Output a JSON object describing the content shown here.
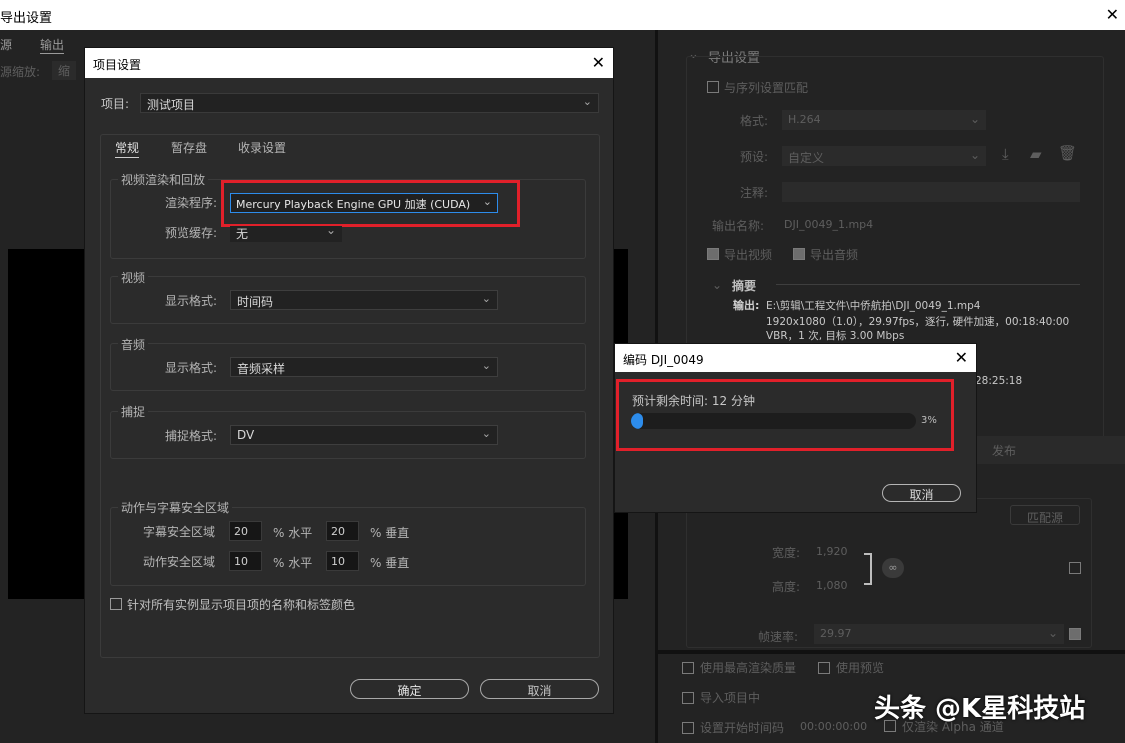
{
  "export_window": {
    "title": "导出设置",
    "tab_source": "源",
    "tab_output": "输出",
    "source_scale_label": "源缩放:",
    "source_scale_value": "缩"
  },
  "export_panel": {
    "section_title": "导出设置",
    "match_sequence": "与序列设置匹配",
    "format_label": "格式:",
    "format_value": "H.264",
    "preset_label": "预设:",
    "preset_value": "自定义",
    "comment_label": "注释:",
    "output_name_label": "输出名称:",
    "output_name_value": "DJI_0049_1.mp4",
    "export_video": "导出视频",
    "export_audio": "导出音频",
    "summary_label": "摘要",
    "output_label": "输出:",
    "output_path": "E:\\剪辑\\工程文件\\中侨航拍\\DJI_0049_1.mp4",
    "output_line2": "1920x1080（1.0），29.97fps，逐行, 硬件加速，00:18:40:00",
    "output_line3": "VBR，1 次, 目标 3.00 Mbps",
    "timecode": "28:25:18",
    "publish_tab": "发布",
    "match_source_button": "匹配源",
    "width_label": "宽度:",
    "width_value": "1,920",
    "height_label": "高度:",
    "height_value": "1,080",
    "framerate_label": "帧速率:",
    "framerate_value": "29.97",
    "max_quality": "使用最高渲染质量",
    "use_previews": "使用预览",
    "import_project": "导入项目中",
    "set_start_tc": "设置开始时间码",
    "start_tc_value": "00:00:00:00",
    "alpha_only": "仅渲染 Alpha 通道"
  },
  "project_dialog": {
    "title": "项目设置",
    "project_label": "项目:",
    "project_value": "测试项目",
    "tabs": [
      "常规",
      "暂存盘",
      "收录设置"
    ],
    "video_render_group": "视频渲染和回放",
    "renderer_label": "渲染程序:",
    "renderer_value": "Mercury Playback Engine GPU 加速 (CUDA)",
    "preview_cache_label": "预览缓存:",
    "preview_cache_value": "无",
    "video_group": "视频",
    "video_display_label": "显示格式:",
    "video_display_value": "时间码",
    "audio_group": "音频",
    "audio_display_label": "显示格式:",
    "audio_display_value": "音频采样",
    "capture_group": "捕捉",
    "capture_format_label": "捕捉格式:",
    "capture_format_value": "DV",
    "safe_group": "动作与字幕安全区域",
    "title_safe_label": "字幕安全区域",
    "title_safe_h": "20",
    "title_safe_v": "20",
    "action_safe_label": "动作安全区域",
    "action_safe_h": "10",
    "action_safe_v": "10",
    "pct_horizontal": "% 水平",
    "pct_vertical": "% 垂直",
    "show_names_checkbox": "针对所有实例显示项目项的名称和标签颜色",
    "ok_button": "确定",
    "cancel_button": "取消"
  },
  "encode_dialog": {
    "title": "编码 DJI_0049",
    "remaining": "预计剩余时间: 12 分钟",
    "progress_percent": 3,
    "progress_label": "3%",
    "cancel_button": "取消"
  },
  "watermark": "头条 @K星科技站",
  "colors": {
    "highlight_red": "#e1202a",
    "progress_blue": "#2d8ceb",
    "selected_field_border": "#2d8ceb"
  }
}
